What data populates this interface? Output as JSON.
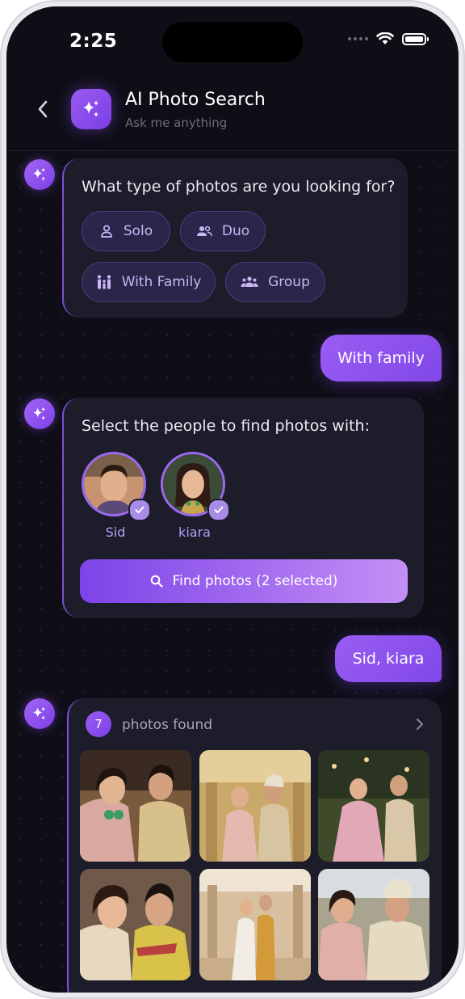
{
  "status_bar": {
    "time": "2:25"
  },
  "header": {
    "title": "AI Photo Search",
    "subtitle": "Ask me anything"
  },
  "question1": {
    "text": "What type of photos are you looking for?",
    "options": [
      {
        "label": "Solo",
        "icon": "person-icon"
      },
      {
        "label": "Duo",
        "icon": "two-people-icon"
      },
      {
        "label": "With Family",
        "icon": "family-icon"
      },
      {
        "label": "Group",
        "icon": "group-icon"
      }
    ]
  },
  "reply1": "With family",
  "question2": {
    "text": "Select the people to find photos with:",
    "people": [
      {
        "name": "Sid",
        "selected": true
      },
      {
        "name": "kiara",
        "selected": true
      }
    ],
    "button_label": "Find photos (2 selected)"
  },
  "reply2": "Sid, kiara",
  "results": {
    "count": "7",
    "label": "photos found",
    "thumbnails": [
      {
        "alt": "couple in wedding attire"
      },
      {
        "alt": "couple dancing"
      },
      {
        "alt": "couple dancing outdoors"
      },
      {
        "alt": "couple smiling"
      },
      {
        "alt": "couple walking in courtyard"
      },
      {
        "alt": "couple at ceremony"
      }
    ]
  },
  "colors": {
    "accent": "#8b4fee",
    "background": "#0f0e17",
    "card": "#1d1c2b"
  }
}
